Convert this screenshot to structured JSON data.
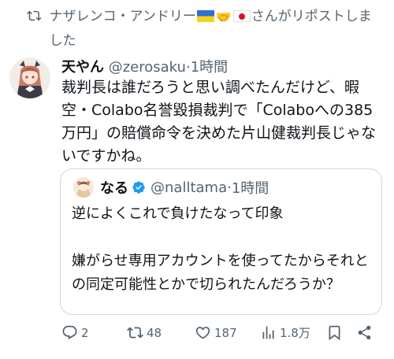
{
  "repost": {
    "text_prefix": "ナザレンコ・アンドリー",
    "text_suffix": "さんがリポストしました"
  },
  "tweet": {
    "display_name": "天やん",
    "handle": "@zerosaku",
    "separator": "·",
    "time": "1時間",
    "body": "裁判長は誰だろうと思い調べたんだけど、暇空・Colabo名誉毀損裁判で「Colaboへの385万円」の賠償命令を決めた片山健裁判長じゃないですかね。"
  },
  "quote": {
    "display_name": "なる",
    "handle": "@nalltama",
    "separator": "·",
    "time": "1時間",
    "line1": "逆によくこれで負けたなって印象",
    "line2": "嫌がらせ専用アカウントを使ってたからそれとの同定可能性とかで切られたんだろうか？"
  },
  "actions": {
    "replies": "2",
    "reposts": "48",
    "likes": "187",
    "views": "1.8万"
  },
  "colors": {
    "text": "#0f1419",
    "secondary": "#536471",
    "border": "#cfd9de",
    "verified": "#1d9bf0"
  },
  "icons": [
    "repost-icon",
    "reply-icon",
    "like-icon",
    "views-icon",
    "bookmark-icon",
    "share-icon",
    "verified-badge-icon"
  ]
}
